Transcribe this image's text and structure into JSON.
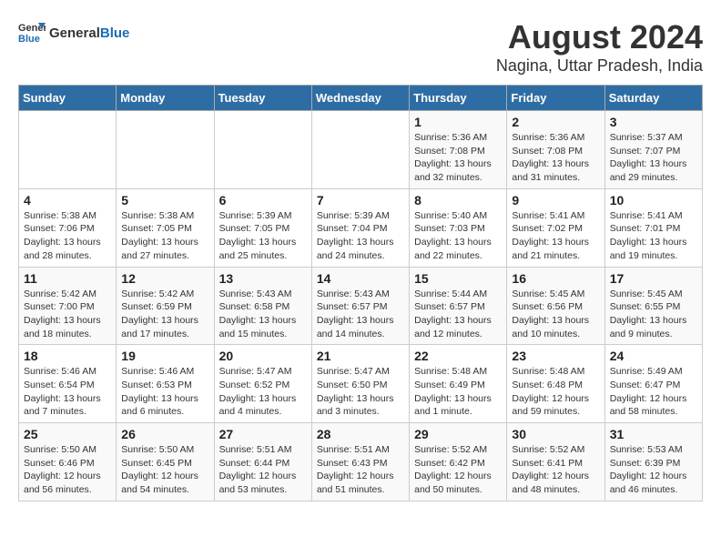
{
  "header": {
    "logo_general": "General",
    "logo_blue": "Blue",
    "main_title": "August 2024",
    "subtitle": "Nagina, Uttar Pradesh, India"
  },
  "calendar": {
    "days_of_week": [
      "Sunday",
      "Monday",
      "Tuesday",
      "Wednesday",
      "Thursday",
      "Friday",
      "Saturday"
    ],
    "weeks": [
      [
        {
          "day": "",
          "info": ""
        },
        {
          "day": "",
          "info": ""
        },
        {
          "day": "",
          "info": ""
        },
        {
          "day": "",
          "info": ""
        },
        {
          "day": "1",
          "info": "Sunrise: 5:36 AM\nSunset: 7:08 PM\nDaylight: 13 hours and 32 minutes."
        },
        {
          "day": "2",
          "info": "Sunrise: 5:36 AM\nSunset: 7:08 PM\nDaylight: 13 hours and 31 minutes."
        },
        {
          "day": "3",
          "info": "Sunrise: 5:37 AM\nSunset: 7:07 PM\nDaylight: 13 hours and 29 minutes."
        }
      ],
      [
        {
          "day": "4",
          "info": "Sunrise: 5:38 AM\nSunset: 7:06 PM\nDaylight: 13 hours and 28 minutes."
        },
        {
          "day": "5",
          "info": "Sunrise: 5:38 AM\nSunset: 7:05 PM\nDaylight: 13 hours and 27 minutes."
        },
        {
          "day": "6",
          "info": "Sunrise: 5:39 AM\nSunset: 7:05 PM\nDaylight: 13 hours and 25 minutes."
        },
        {
          "day": "7",
          "info": "Sunrise: 5:39 AM\nSunset: 7:04 PM\nDaylight: 13 hours and 24 minutes."
        },
        {
          "day": "8",
          "info": "Sunrise: 5:40 AM\nSunset: 7:03 PM\nDaylight: 13 hours and 22 minutes."
        },
        {
          "day": "9",
          "info": "Sunrise: 5:41 AM\nSunset: 7:02 PM\nDaylight: 13 hours and 21 minutes."
        },
        {
          "day": "10",
          "info": "Sunrise: 5:41 AM\nSunset: 7:01 PM\nDaylight: 13 hours and 19 minutes."
        }
      ],
      [
        {
          "day": "11",
          "info": "Sunrise: 5:42 AM\nSunset: 7:00 PM\nDaylight: 13 hours and 18 minutes."
        },
        {
          "day": "12",
          "info": "Sunrise: 5:42 AM\nSunset: 6:59 PM\nDaylight: 13 hours and 17 minutes."
        },
        {
          "day": "13",
          "info": "Sunrise: 5:43 AM\nSunset: 6:58 PM\nDaylight: 13 hours and 15 minutes."
        },
        {
          "day": "14",
          "info": "Sunrise: 5:43 AM\nSunset: 6:57 PM\nDaylight: 13 hours and 14 minutes."
        },
        {
          "day": "15",
          "info": "Sunrise: 5:44 AM\nSunset: 6:57 PM\nDaylight: 13 hours and 12 minutes."
        },
        {
          "day": "16",
          "info": "Sunrise: 5:45 AM\nSunset: 6:56 PM\nDaylight: 13 hours and 10 minutes."
        },
        {
          "day": "17",
          "info": "Sunrise: 5:45 AM\nSunset: 6:55 PM\nDaylight: 13 hours and 9 minutes."
        }
      ],
      [
        {
          "day": "18",
          "info": "Sunrise: 5:46 AM\nSunset: 6:54 PM\nDaylight: 13 hours and 7 minutes."
        },
        {
          "day": "19",
          "info": "Sunrise: 5:46 AM\nSunset: 6:53 PM\nDaylight: 13 hours and 6 minutes."
        },
        {
          "day": "20",
          "info": "Sunrise: 5:47 AM\nSunset: 6:52 PM\nDaylight: 13 hours and 4 minutes."
        },
        {
          "day": "21",
          "info": "Sunrise: 5:47 AM\nSunset: 6:50 PM\nDaylight: 13 hours and 3 minutes."
        },
        {
          "day": "22",
          "info": "Sunrise: 5:48 AM\nSunset: 6:49 PM\nDaylight: 13 hours and 1 minute."
        },
        {
          "day": "23",
          "info": "Sunrise: 5:48 AM\nSunset: 6:48 PM\nDaylight: 12 hours and 59 minutes."
        },
        {
          "day": "24",
          "info": "Sunrise: 5:49 AM\nSunset: 6:47 PM\nDaylight: 12 hours and 58 minutes."
        }
      ],
      [
        {
          "day": "25",
          "info": "Sunrise: 5:50 AM\nSunset: 6:46 PM\nDaylight: 12 hours and 56 minutes."
        },
        {
          "day": "26",
          "info": "Sunrise: 5:50 AM\nSunset: 6:45 PM\nDaylight: 12 hours and 54 minutes."
        },
        {
          "day": "27",
          "info": "Sunrise: 5:51 AM\nSunset: 6:44 PM\nDaylight: 12 hours and 53 minutes."
        },
        {
          "day": "28",
          "info": "Sunrise: 5:51 AM\nSunset: 6:43 PM\nDaylight: 12 hours and 51 minutes."
        },
        {
          "day": "29",
          "info": "Sunrise: 5:52 AM\nSunset: 6:42 PM\nDaylight: 12 hours and 50 minutes."
        },
        {
          "day": "30",
          "info": "Sunrise: 5:52 AM\nSunset: 6:41 PM\nDaylight: 12 hours and 48 minutes."
        },
        {
          "day": "31",
          "info": "Sunrise: 5:53 AM\nSunset: 6:39 PM\nDaylight: 12 hours and 46 minutes."
        }
      ]
    ]
  }
}
